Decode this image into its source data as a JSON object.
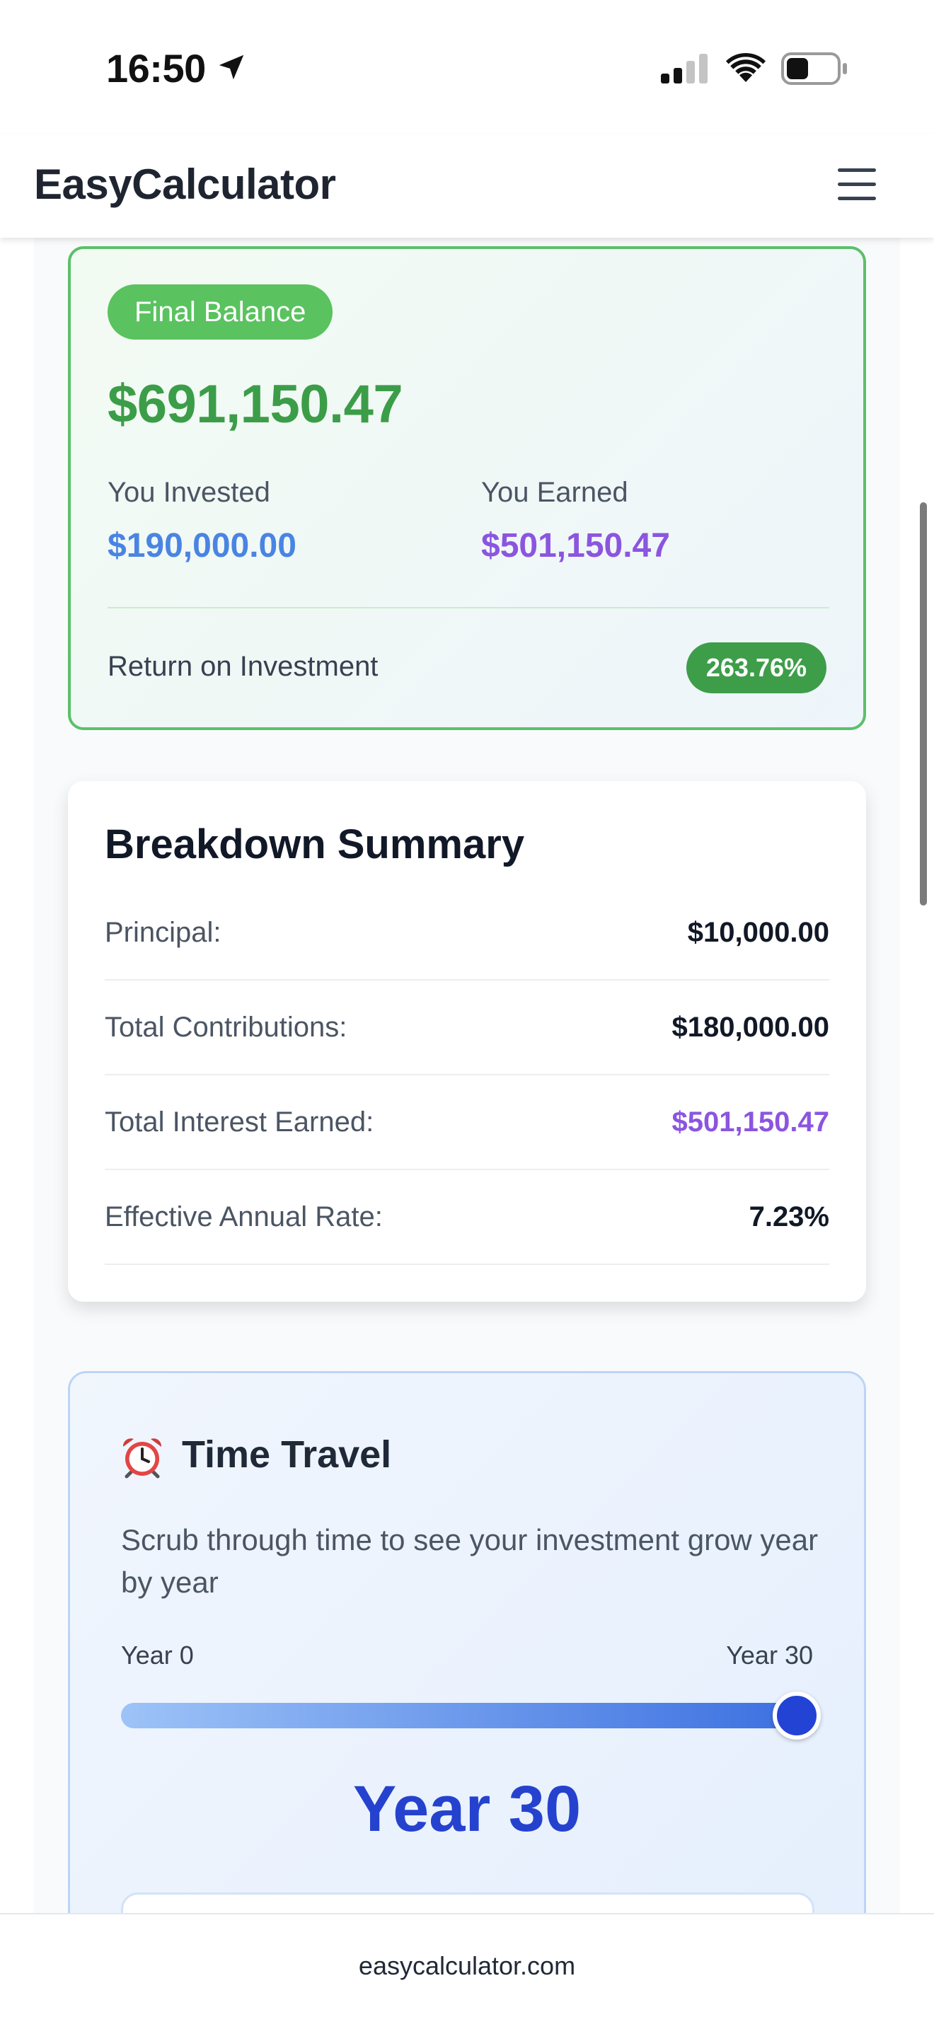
{
  "status_bar": {
    "time": "16:50"
  },
  "header": {
    "title": "EasyCalculator",
    "menu_icon": "hamburger-menu-icon"
  },
  "final_balance": {
    "pill_label": "Final Balance",
    "amount": "$691,150.47",
    "invested_label": "You Invested",
    "invested_value": "$190,000.00",
    "earned_label": "You Earned",
    "earned_value": "$501,150.47",
    "roi_label": "Return on Investment",
    "roi_value": "263.76%"
  },
  "breakdown": {
    "title": "Breakdown Summary",
    "rows": [
      {
        "label": "Principal:",
        "value": "$10,000.00"
      },
      {
        "label": "Total Contributions:",
        "value": "$180,000.00"
      },
      {
        "label": "Total Interest Earned:",
        "value": "$501,150.47"
      },
      {
        "label": "Effective Annual Rate:",
        "value": "7.23%"
      }
    ]
  },
  "time_travel": {
    "icon": "alarm-clock-icon",
    "title": "Time Travel",
    "description": "Scrub through time to see your investment grow year by year",
    "min_label": "Year 0",
    "max_label": "Year 30",
    "slider_value_fraction": 1.0,
    "year_display": "Year 30"
  },
  "url_bar": {
    "url": "easycalculator.com"
  },
  "colors": {
    "success_green": "#3c9d48",
    "invested_blue": "#4a84e3",
    "earned_purple": "#8b55e0",
    "slider_blue": "#2343d4"
  }
}
